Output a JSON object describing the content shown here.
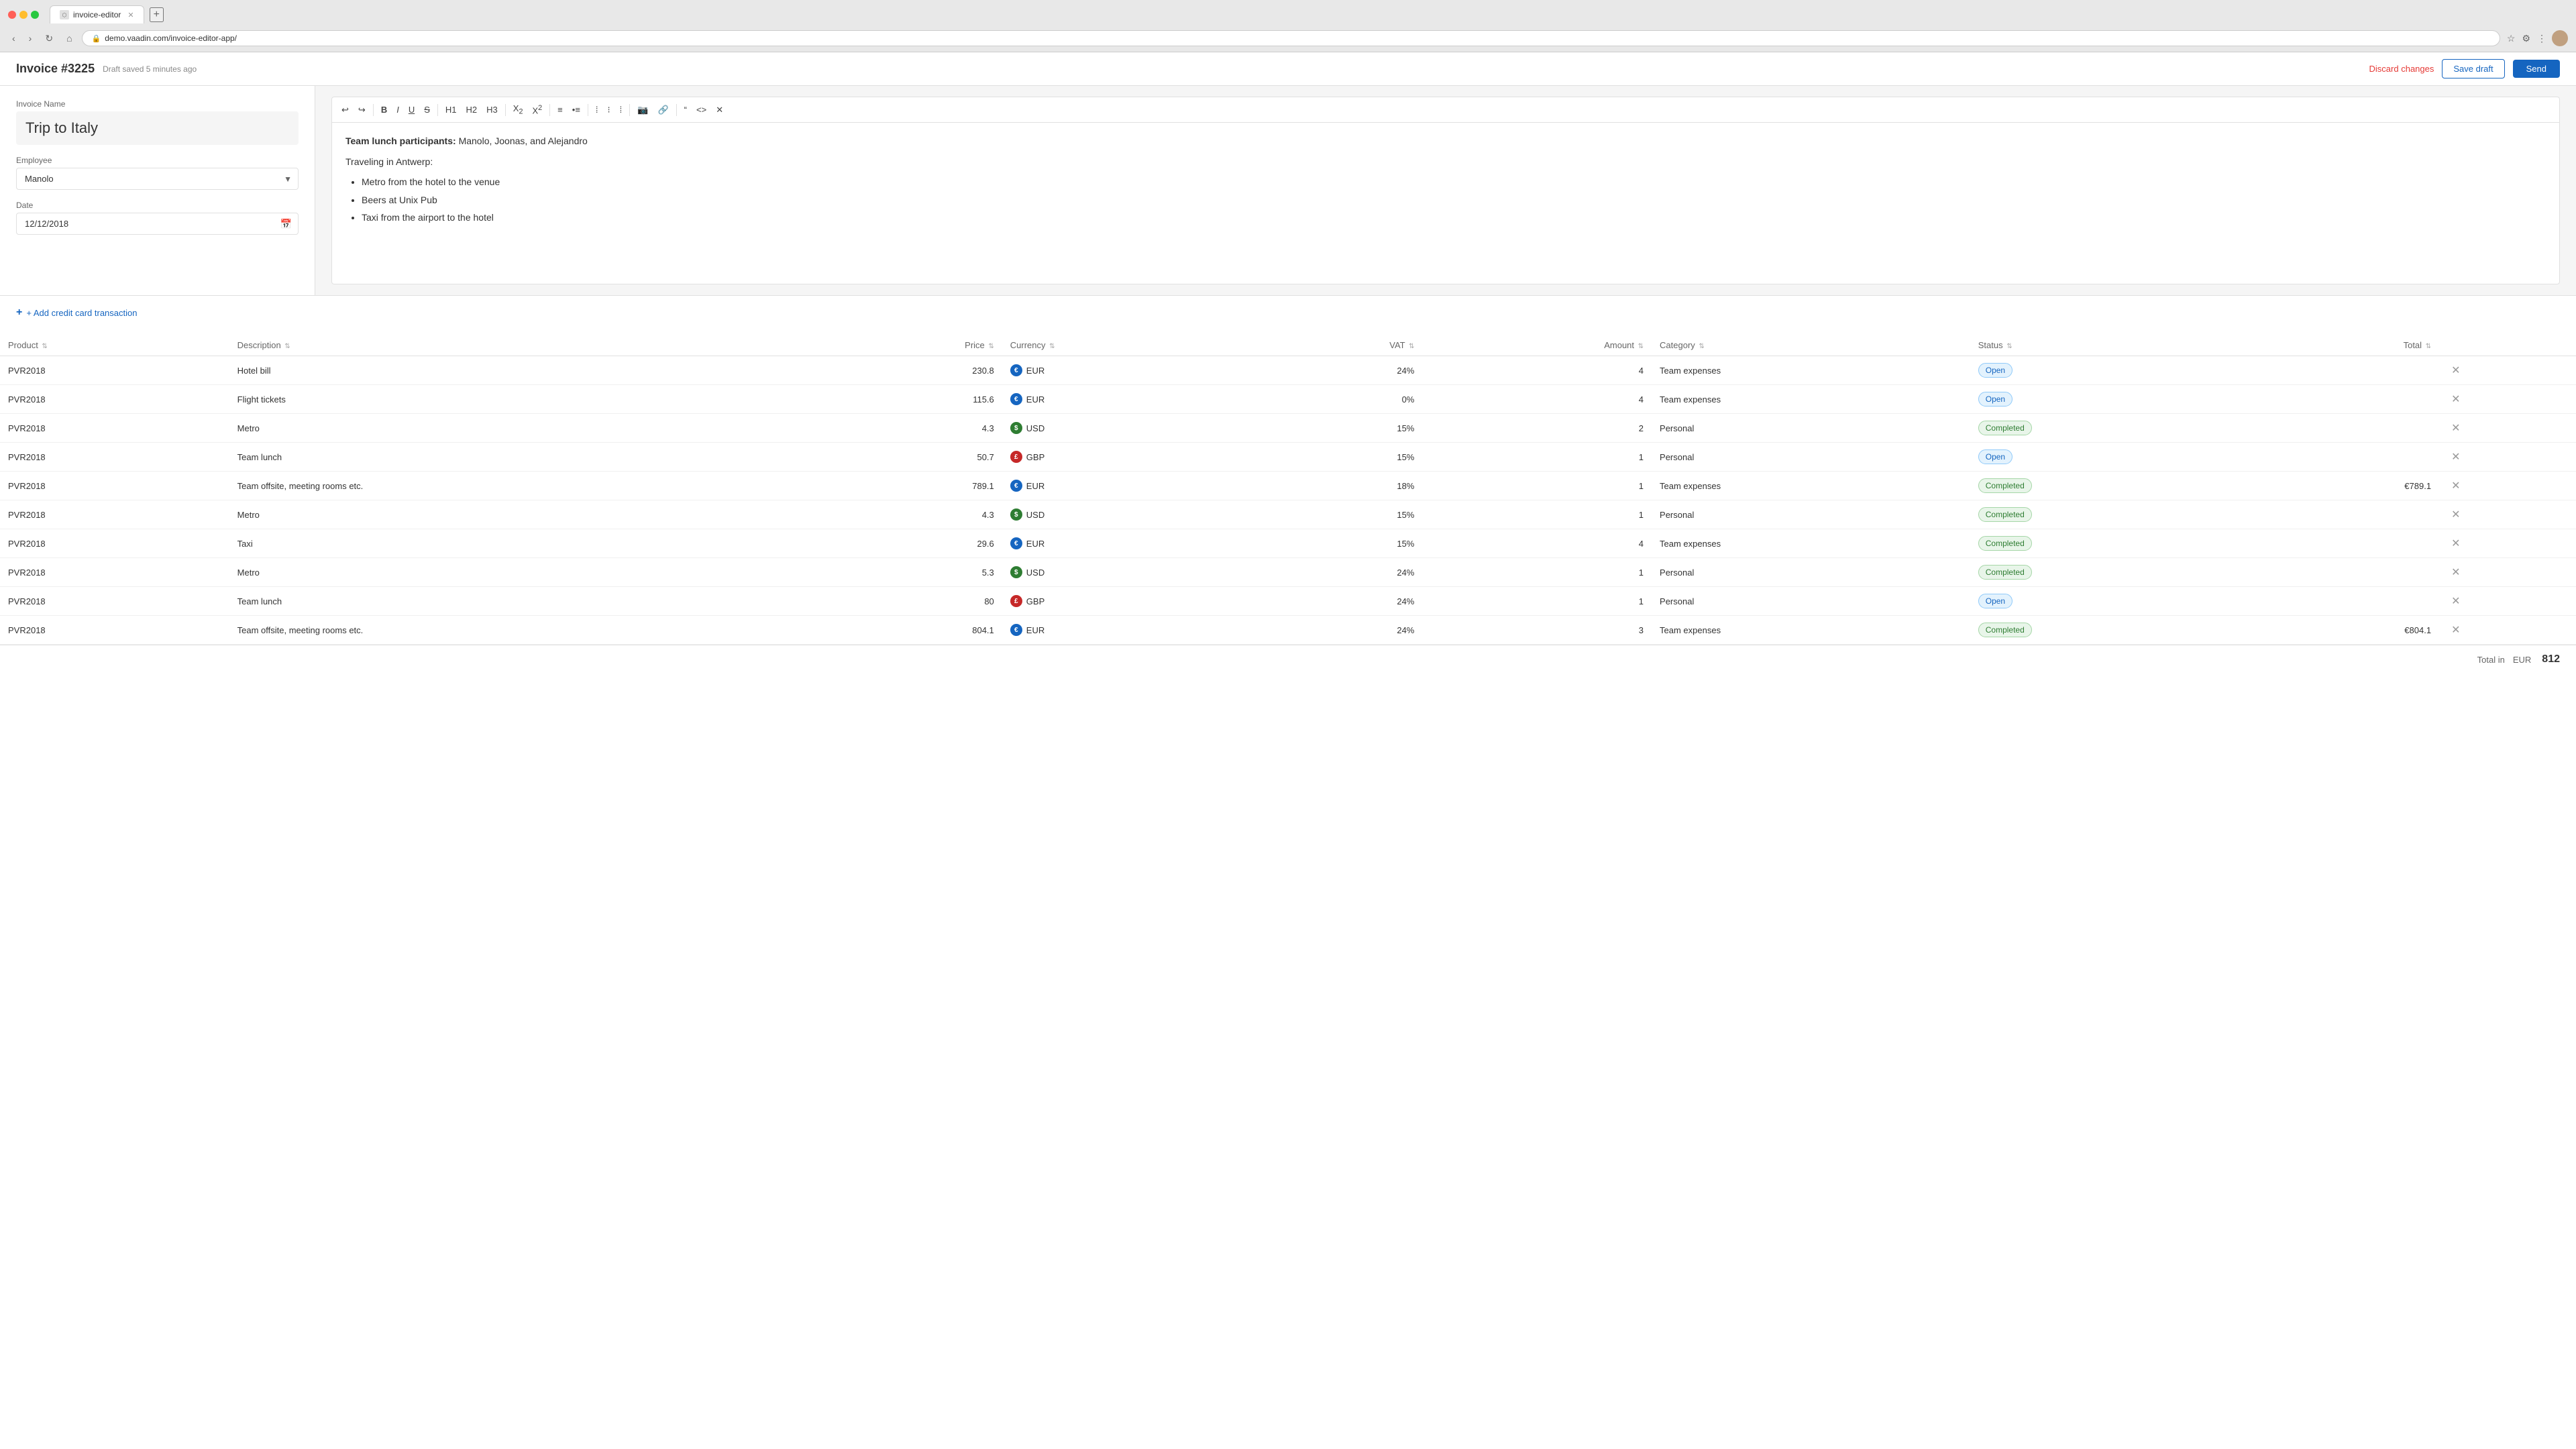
{
  "browser": {
    "tab_label": "invoice-editor",
    "url": "demo.vaadin.com/invoice-editor-app/",
    "new_tab_symbol": "+",
    "back": "‹",
    "forward": "›",
    "refresh": "↻",
    "home": "⌂"
  },
  "header": {
    "invoice_id": "Invoice #3225",
    "draft_status": "Draft saved 5 minutes ago",
    "discard_label": "Discard changes",
    "save_draft_label": "Save draft",
    "send_label": "Send"
  },
  "left_panel": {
    "invoice_name_label": "Invoice Name",
    "invoice_name_value": "Trip to Italy",
    "employee_label": "Employee",
    "employee_value": "Manolo",
    "date_label": "Date",
    "date_value": "12/12/2018"
  },
  "editor": {
    "content_html": "rich_text"
  },
  "toolbar": {
    "undo": "↩",
    "redo": "↪",
    "bold": "B",
    "italic": "I",
    "underline": "U",
    "strikethrough": "S̶",
    "h1": "H1",
    "h2": "H2",
    "h3": "H3",
    "subscript": "X₂",
    "superscript": "X²",
    "ordered_list": "≡",
    "unordered_list": "•≡",
    "align_left": "≡",
    "align_center": "≡",
    "align_right": "≡",
    "image": "🖼",
    "link": "🔗",
    "blockquote": "\"",
    "code": "<>",
    "clear": "✕"
  },
  "add_transaction_label": "+ Add credit card transaction",
  "table": {
    "columns": [
      {
        "key": "product",
        "label": "Product"
      },
      {
        "key": "description",
        "label": "Description"
      },
      {
        "key": "price",
        "label": "Price"
      },
      {
        "key": "currency",
        "label": "Currency"
      },
      {
        "key": "vat",
        "label": "VAT"
      },
      {
        "key": "amount",
        "label": "Amount"
      },
      {
        "key": "category",
        "label": "Category"
      },
      {
        "key": "status",
        "label": "Status"
      },
      {
        "key": "total",
        "label": "Total"
      }
    ],
    "rows": [
      {
        "product": "PVR2018",
        "description": "Hotel bill",
        "price": "230.8",
        "currency": "EUR",
        "currency_type": "eur",
        "vat": "24%",
        "amount": "4",
        "category": "Team expenses",
        "status": "Open",
        "total": ""
      },
      {
        "product": "PVR2018",
        "description": "Flight tickets",
        "price": "115.6",
        "currency": "EUR",
        "currency_type": "eur",
        "vat": "0%",
        "amount": "4",
        "category": "Team expenses",
        "status": "Open",
        "total": ""
      },
      {
        "product": "PVR2018",
        "description": "Metro",
        "price": "4.3",
        "currency": "USD",
        "currency_type": "usd",
        "vat": "15%",
        "amount": "2",
        "category": "Personal",
        "status": "Completed",
        "total": ""
      },
      {
        "product": "PVR2018",
        "description": "Team lunch",
        "price": "50.7",
        "currency": "GBP",
        "currency_type": "gbp",
        "vat": "15%",
        "amount": "1",
        "category": "Personal",
        "status": "Open",
        "total": ""
      },
      {
        "product": "PVR2018",
        "description": "Team offsite, meeting rooms etc.",
        "price": "789.1",
        "currency": "EUR",
        "currency_type": "eur",
        "vat": "18%",
        "amount": "1",
        "category": "Team expenses",
        "status": "Completed",
        "total": "€789.1"
      },
      {
        "product": "PVR2018",
        "description": "Metro",
        "price": "4.3",
        "currency": "USD",
        "currency_type": "usd",
        "vat": "15%",
        "amount": "1",
        "category": "Personal",
        "status": "Completed",
        "total": ""
      },
      {
        "product": "PVR2018",
        "description": "Taxi",
        "price": "29.6",
        "currency": "EUR",
        "currency_type": "eur",
        "vat": "15%",
        "amount": "4",
        "category": "Team expenses",
        "status": "Completed",
        "total": ""
      },
      {
        "product": "PVR2018",
        "description": "Metro",
        "price": "5.3",
        "currency": "USD",
        "currency_type": "usd",
        "vat": "24%",
        "amount": "1",
        "category": "Personal",
        "status": "Completed",
        "total": ""
      },
      {
        "product": "PVR2018",
        "description": "Team lunch",
        "price": "80",
        "currency": "GBP",
        "currency_type": "gbp",
        "vat": "24%",
        "amount": "1",
        "category": "Personal",
        "status": "Open",
        "total": ""
      },
      {
        "product": "PVR2018",
        "description": "Team offsite, meeting rooms etc.",
        "price": "804.1",
        "currency": "EUR",
        "currency_type": "eur",
        "vat": "24%",
        "amount": "3",
        "category": "Team expenses",
        "status": "Completed",
        "total": "€804.1"
      }
    ]
  },
  "footer": {
    "total_label": "Total in",
    "total_currency": "EUR",
    "total_amount": "812"
  }
}
